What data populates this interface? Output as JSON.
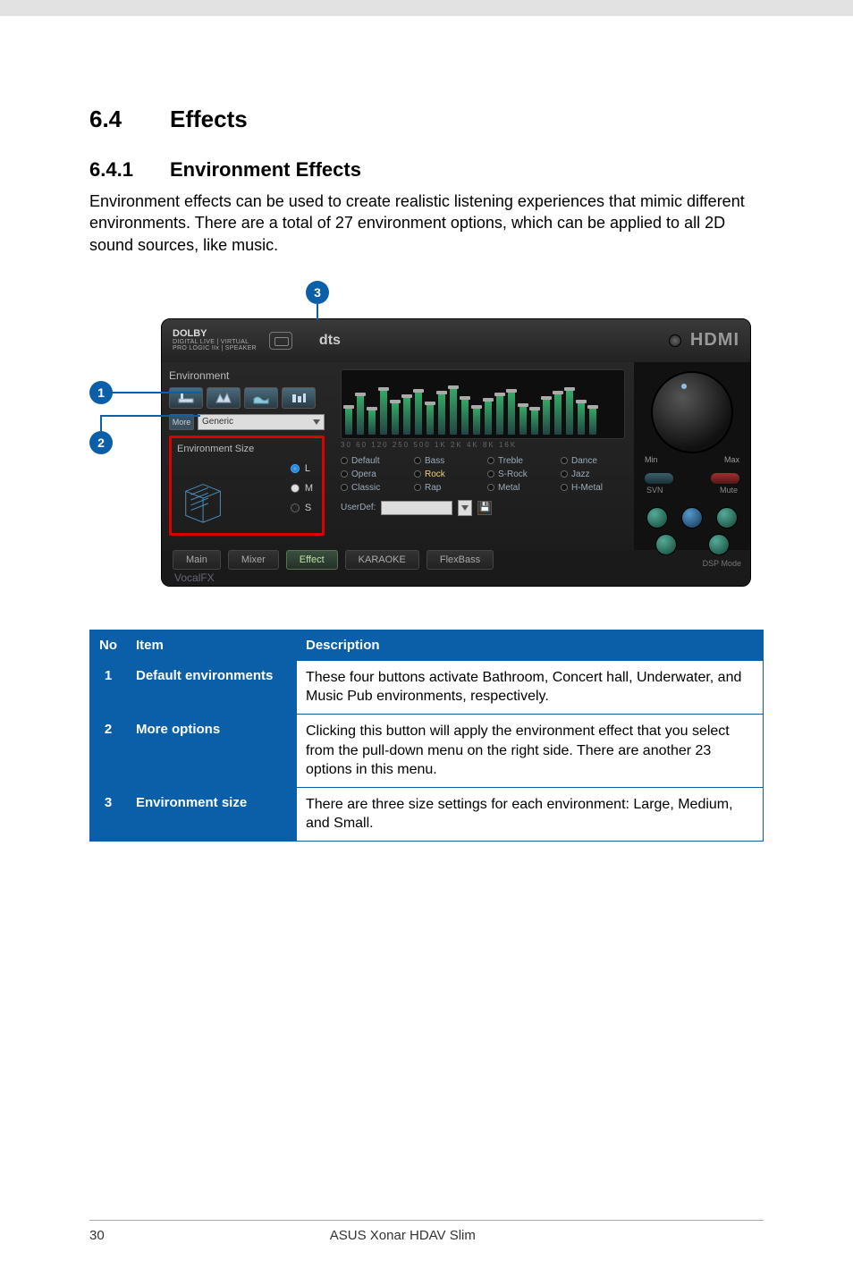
{
  "section": {
    "num": "6.4",
    "title": "Effects"
  },
  "subsection": {
    "num": "6.4.1",
    "title": "Environment Effects"
  },
  "paragraph": "Environment effects can be used to create realistic listening experiences that mimic different environments. There are a total of 27 environment options, which can be applied to all 2D sound sources, like music.",
  "callouts": {
    "c1": "1",
    "c2": "2",
    "c3": "3"
  },
  "app": {
    "dolby": {
      "brand": "DOLBY",
      "sub1": "DIGITAL LIVE | VIRTUAL",
      "sub2": "PRO LOGIC IIx | SPEAKER"
    },
    "dts": {
      "label": "dts",
      "sub": ""
    },
    "hdmi": "HDMI",
    "env_label": "Environment",
    "more_label": "More",
    "env_select": "Generic",
    "env_size_label": "Environment Size",
    "size_options": [
      "L",
      "M",
      "S"
    ],
    "presets": [
      "Default",
      "Bass",
      "Treble",
      "Dance",
      "Opera",
      "Rock",
      "S-Rock",
      "Jazz",
      "Classic",
      "Rap",
      "Metal",
      "H-Metal"
    ],
    "preset_hl_index": 5,
    "userdef_label": "UserDef:",
    "eq_heights": [
      30,
      44,
      28,
      50,
      36,
      42,
      48,
      34,
      46,
      52,
      40,
      30,
      38,
      44,
      48,
      32,
      28,
      40,
      46,
      50,
      36,
      30
    ],
    "eq_axis": "30  60  120  250  500  1K  2K  4K  8K  16K",
    "knob_min": "Min",
    "knob_max": "Max",
    "svn_label": "SVN",
    "mute_label": "Mute",
    "dsp_label": "DSP Mode",
    "tabs": [
      "Main",
      "Mixer",
      "Effect",
      "KARAOKE",
      "FlexBass"
    ],
    "tab_active_index": 2,
    "vocalfx": "VocalFX"
  },
  "table": {
    "headers": [
      "No",
      "Item",
      "Description"
    ],
    "rows": [
      {
        "no": "1",
        "item": "Default environments",
        "desc": "These four buttons activate Bathroom, Concert hall, Underwater, and Music Pub environments, respectively."
      },
      {
        "no": "2",
        "item": "More options",
        "desc": "Clicking this button will apply the environment effect that you select from the pull-down menu on the right side. There are another 23 options in this menu."
      },
      {
        "no": "3",
        "item": "Environment size",
        "desc": "There are three size settings for each environment: Large, Medium, and Small."
      }
    ]
  },
  "footer": {
    "page": "30",
    "title": "ASUS Xonar HDAV Slim"
  }
}
